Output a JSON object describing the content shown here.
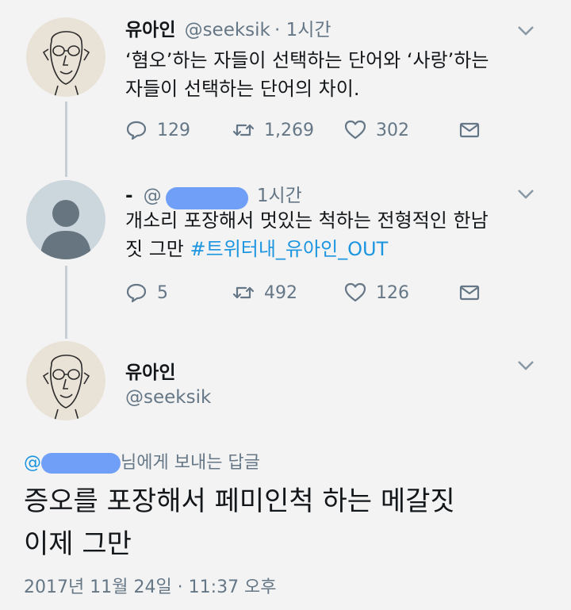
{
  "tweet1": {
    "name": "유아인",
    "handle": "@seeksik",
    "time": "· 1시간",
    "line1": "‘혐오’하는 자들이 선택하는 단어와 ‘사랑’하는",
    "line2": "자들이 선택하는 단어의 차이.",
    "reply_count": "129",
    "retweet_count": "1,269",
    "like_count": "302"
  },
  "tweet2": {
    "name": "-",
    "handle_prefix": "@",
    "time": "1시간",
    "line1": "개소리 포장해서 멋있는 척하는 전형적인 한남",
    "line2_text": "짓 그만 ",
    "hashtag": "#트위터내_유아인_OUT",
    "reply_count": "5",
    "retweet_count": "492",
    "like_count": "126"
  },
  "tweet3": {
    "name": "유아인",
    "handle": "@seeksik",
    "reply_at": "@",
    "reply_suffix": "님에게 보내는 답글",
    "line1": "증오를 포장해서 페미인척 하는 메갈짓",
    "line2": "이제 그만",
    "timestamp": "2017년 11월 24일 · 11:37 오후"
  },
  "colors": {
    "background": "#f3f3f3",
    "link": "#1b95e0",
    "muted": "#657786",
    "redaction": "#6f9ff7"
  },
  "icons": [
    "reply-icon",
    "retweet-icon",
    "like-icon",
    "dm-icon",
    "chevron-down-icon"
  ]
}
